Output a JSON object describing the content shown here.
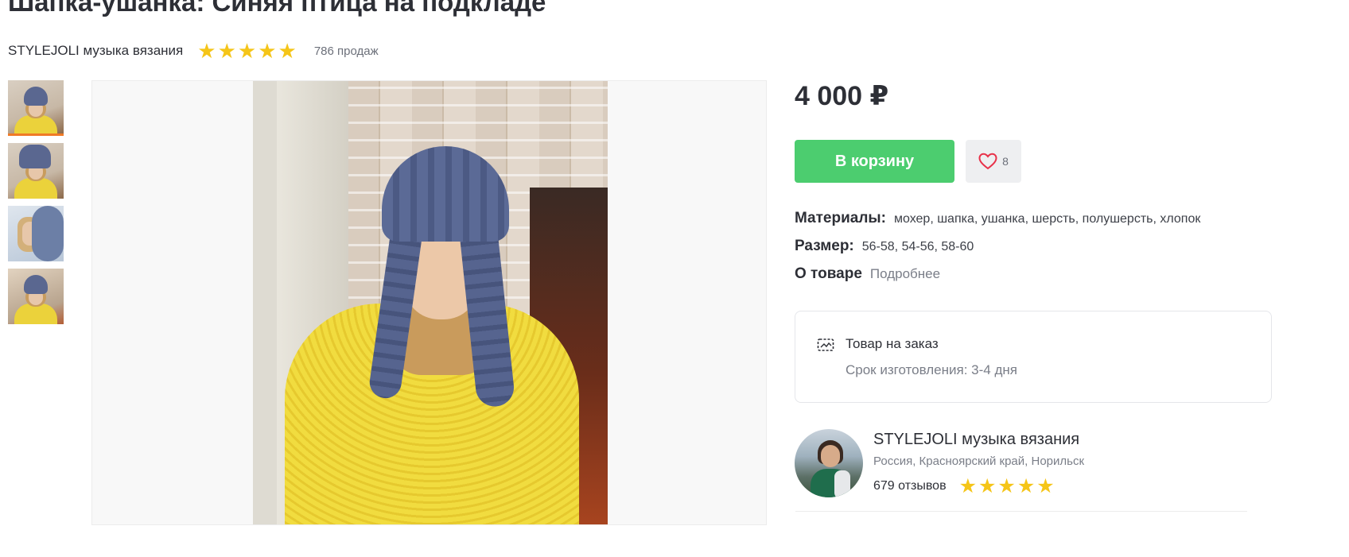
{
  "product": {
    "title": "Шапка-ушанка: Синяя птица на подкладе",
    "price": "4 000 ₽",
    "cart_label": "В корзину",
    "favorites_count": "8"
  },
  "shop": {
    "name": "STYLEJOLI музыка вязания",
    "sales": "786 продаж",
    "rating_stars": 5
  },
  "gallery": {
    "thumbnail_count": 4,
    "active_index": 0
  },
  "properties": {
    "materials_label": "Материалы:",
    "materials_value": "мохер, шапка, ушанка, шерсть, полушерсть, хлопок",
    "size_label": "Размер:",
    "size_value": "56-58, 54-56, 58-60",
    "about_label": "О товаре",
    "about_link": "Подробнее"
  },
  "order": {
    "title": "Товар на заказ",
    "term": "Срок изготовления: 3-4 дня"
  },
  "seller": {
    "name": "STYLEJOLI музыка вязания",
    "location": "Россия, Красноярский край, Норильск",
    "reviews": "679 отзывов",
    "rating_stars": 5
  },
  "colors": {
    "accent_green": "#4ccd6f",
    "star_yellow": "#f5c518",
    "active_thumb": "#f07a26",
    "heart_red": "#e8324a"
  },
  "icons": {
    "star": "★",
    "heart": "heart-outline-icon",
    "order": "made-to-order-icon"
  }
}
